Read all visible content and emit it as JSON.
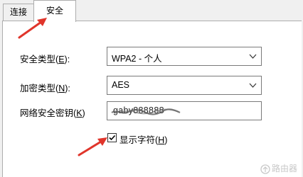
{
  "tabs": [
    {
      "label": "连接",
      "active": false
    },
    {
      "label": "安全",
      "active": true
    }
  ],
  "form": {
    "security_type": {
      "label": "安全类型",
      "mnemonic": "E",
      "value": "WPA2 - 个人"
    },
    "encryption_type": {
      "label": "加密类型",
      "mnemonic": "N",
      "value": "AES"
    },
    "network_key": {
      "label": "网络安全密钥",
      "mnemonic": "K",
      "value": "gaby888888"
    },
    "show_characters": {
      "label": "显示字符",
      "mnemonic": "H",
      "checked": true
    }
  },
  "icons": {
    "dropdown": "chevron-down-icon",
    "check": "checkmark-icon",
    "annotation": "red-arrow-icon"
  },
  "colors": {
    "accent_red": "#e0352b",
    "panel_bg": "#ffffff",
    "window_bg": "#f0f0f0",
    "border": "#7a7a7a"
  },
  "watermark": {
    "text": "路由器"
  }
}
